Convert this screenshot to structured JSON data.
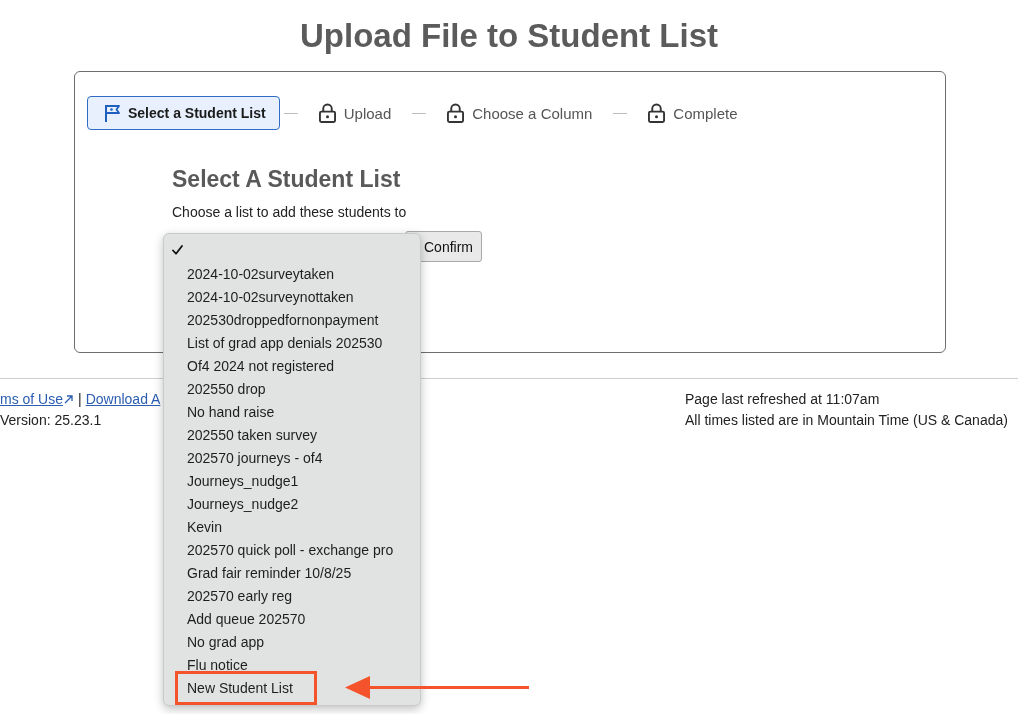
{
  "page": {
    "title": "Upload File to Student List"
  },
  "steps": [
    {
      "label": "Select a Student List",
      "selected": true,
      "locked": false
    },
    {
      "label": "Upload",
      "selected": false,
      "locked": true
    },
    {
      "label": "Choose a Column",
      "selected": false,
      "locked": true
    },
    {
      "label": "Complete",
      "selected": false,
      "locked": true
    }
  ],
  "form": {
    "heading": "Select A Student List",
    "instruction": "Choose a list to add these students to",
    "confirm_button": "Confirm"
  },
  "dropdown": {
    "options": [
      {
        "selected": true,
        "callout": false
      },
      {
        "label": "2024-10-02surveytaken",
        "selected": false,
        "callout": false
      },
      {
        "label": "2024-10-02surveynottaken",
        "selected": false,
        "callout": false
      },
      {
        "label": "202530droppedfornonpayment",
        "selected": false,
        "callout": false
      },
      {
        "label": "List of grad app denials 202530",
        "selected": false,
        "callout": false
      },
      {
        "label": "Of4 2024 not registered",
        "selected": false,
        "callout": false
      },
      {
        "label": "202550 drop",
        "selected": false,
        "callout": false
      },
      {
        "label": "No hand raise",
        "selected": false,
        "callout": false
      },
      {
        "label": "202550 taken survey",
        "selected": false,
        "callout": false
      },
      {
        "label": "202570 journeys - of4",
        "selected": false,
        "callout": false
      },
      {
        "label": "Journeys_nudge1",
        "selected": false,
        "callout": false
      },
      {
        "label": "Journeys_nudge2",
        "selected": false,
        "callout": false
      },
      {
        "label": "Kevin",
        "selected": false,
        "callout": false
      },
      {
        "label": "202570 quick poll - exchange pro",
        "selected": false,
        "callout": false
      },
      {
        "label": "Grad fair reminder 10/8/25",
        "selected": false,
        "callout": false
      },
      {
        "label": "202570 early reg",
        "selected": false,
        "callout": false
      },
      {
        "label": "Add queue 202570",
        "selected": false,
        "callout": false
      },
      {
        "label": "No grad app",
        "selected": false,
        "callout": false
      },
      {
        "label": "Flu notice",
        "selected": false,
        "callout": false
      },
      {
        "label": "New Student List",
        "selected": false,
        "callout": true
      }
    ]
  },
  "footer": {
    "links": [
      {
        "label": "ms of Use",
        "external": true
      },
      {
        "label": "Download A",
        "external": false
      }
    ],
    "link_separator": "|",
    "version": "Version: 25.23.1",
    "refreshed": "Page last refreshed at 11:07am",
    "timezone": "All times listed are in Mountain Time (US & Canada)"
  }
}
